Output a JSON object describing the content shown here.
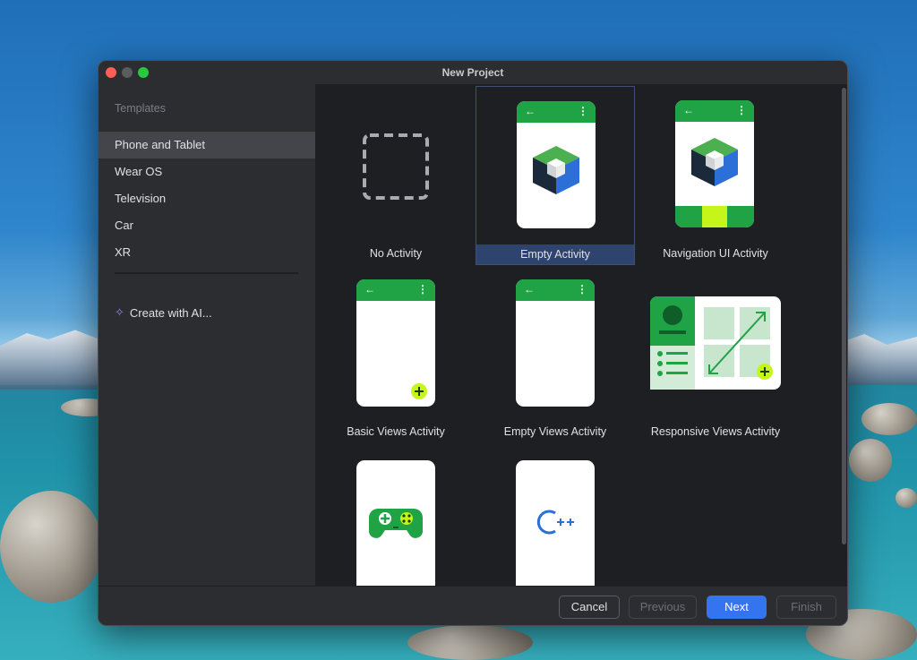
{
  "window": {
    "title": "New Project"
  },
  "sidebar": {
    "header": "Templates",
    "items": [
      {
        "label": "Phone and Tablet",
        "selected": true
      },
      {
        "label": "Wear OS",
        "selected": false
      },
      {
        "label": "Television",
        "selected": false
      },
      {
        "label": "Car",
        "selected": false
      },
      {
        "label": "XR",
        "selected": false
      }
    ],
    "ai_item": {
      "label": "Create with AI...",
      "icon": "sparkle-icon"
    }
  },
  "templates": [
    {
      "label": "No Activity"
    },
    {
      "label": "Empty Activity",
      "selected": true
    },
    {
      "label": "Navigation UI Activity"
    },
    {
      "label": "Basic Views Activity"
    },
    {
      "label": "Empty Views Activity"
    },
    {
      "label": "Responsive Views Activity"
    },
    {
      "label": ""
    },
    {
      "label": ""
    }
  ],
  "icons": {
    "back": "←",
    "menu": "⋮",
    "cpp": "C++"
  },
  "footer": {
    "cancel": "Cancel",
    "previous": "Previous",
    "next": "Next",
    "finish": "Finish"
  },
  "colors": {
    "accent": "#3574f0",
    "android_green": "#1fa345",
    "lime": "#c6f51a",
    "selection": "#2e436e"
  }
}
